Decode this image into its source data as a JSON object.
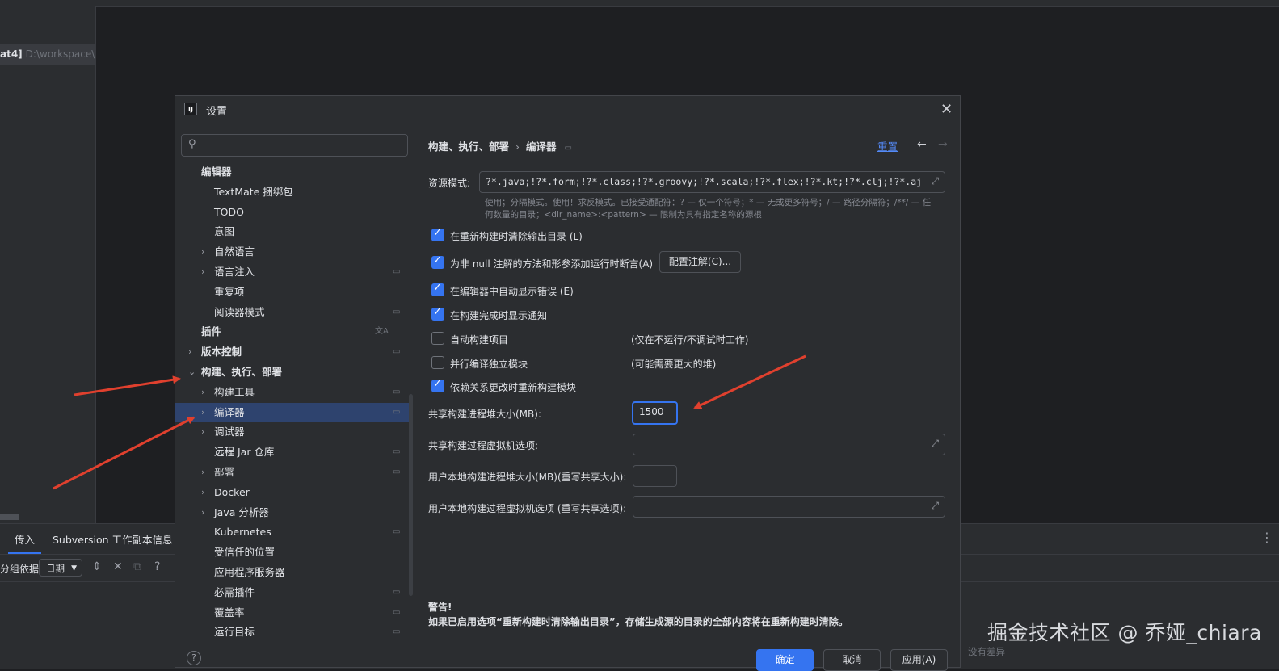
{
  "ide": {
    "tab_bold": "at4]",
    "tab_path": "D:\\workspace\\",
    "bottom_tabs": [
      "传入",
      "Subversion 工作副本信息"
    ],
    "group_by_label": "分组依据",
    "group_by_value": "日期",
    "no_diff": "没有差异",
    "more_icon": "more-vertical-icon"
  },
  "dialog": {
    "title": "设置",
    "search_placeholder": "",
    "tree": [
      {
        "label": "编辑器",
        "level": 0,
        "bold": true,
        "chevron": "",
        "pinned": false
      },
      {
        "label": "TextMate 捆绑包",
        "level": 1,
        "bold": false,
        "chevron": "",
        "pinned": false
      },
      {
        "label": "TODO",
        "level": 1,
        "bold": false,
        "chevron": "",
        "pinned": false
      },
      {
        "label": "意图",
        "level": 1,
        "bold": false,
        "chevron": "",
        "pinned": false
      },
      {
        "label": "自然语言",
        "level": 1,
        "bold": false,
        "chevron": "›",
        "pinned": false
      },
      {
        "label": "语言注入",
        "level": 1,
        "bold": false,
        "chevron": "›",
        "pinned": true
      },
      {
        "label": "重复项",
        "level": 1,
        "bold": false,
        "chevron": "",
        "pinned": false
      },
      {
        "label": "阅读器模式",
        "level": 1,
        "bold": false,
        "chevron": "",
        "pinned": true
      },
      {
        "label": "插件",
        "level": 0,
        "bold": true,
        "chevron": "",
        "pinned": false,
        "translate": true
      },
      {
        "label": "版本控制",
        "level": 0,
        "bold": true,
        "chevron": "›",
        "pinned": true
      },
      {
        "label": "构建、执行、部署",
        "level": 0,
        "bold": true,
        "chevron": "⌄",
        "pinned": false
      },
      {
        "label": "构建工具",
        "level": 1,
        "bold": false,
        "chevron": "›",
        "pinned": true
      },
      {
        "label": "编译器",
        "level": 1,
        "bold": false,
        "chevron": "›",
        "pinned": true,
        "selected": true
      },
      {
        "label": "调试器",
        "level": 1,
        "bold": false,
        "chevron": "›",
        "pinned": false
      },
      {
        "label": "远程 Jar 仓库",
        "level": 1,
        "bold": false,
        "chevron": "",
        "pinned": true
      },
      {
        "label": "部署",
        "level": 1,
        "bold": false,
        "chevron": "›",
        "pinned": true
      },
      {
        "label": "Docker",
        "level": 1,
        "bold": false,
        "chevron": "›",
        "pinned": false
      },
      {
        "label": "Java 分析器",
        "level": 1,
        "bold": false,
        "chevron": "›",
        "pinned": false
      },
      {
        "label": "Kubernetes",
        "level": 1,
        "bold": false,
        "chevron": "",
        "pinned": true
      },
      {
        "label": "受信任的位置",
        "level": 1,
        "bold": false,
        "chevron": "",
        "pinned": false
      },
      {
        "label": "应用程序服务器",
        "level": 1,
        "bold": false,
        "chevron": "",
        "pinned": false
      },
      {
        "label": "必需插件",
        "level": 1,
        "bold": false,
        "chevron": "",
        "pinned": true
      },
      {
        "label": "覆盖率",
        "level": 1,
        "bold": false,
        "chevron": "",
        "pinned": true
      },
      {
        "label": "运行目标",
        "level": 1,
        "bold": false,
        "chevron": "",
        "pinned": true
      }
    ],
    "breadcrumb": [
      "构建、执行、部署",
      "编译器"
    ],
    "reset": "重置",
    "resource_label": "资源模式:",
    "resource_value": "?*.java;!?*.form;!?*.class;!?*.groovy;!?*.scala;!?*.flex;!?*.kt;!?*.clj;!?*.aj",
    "hint_line1": "使用；分隔模式。使用！求反模式。已接受通配符：? — 仅一个符号；* — 无或更多符号；/ — 路径分隔符；/**/ — 任",
    "hint_line2": "何数量的目录；<dir_name>:<pattern> — 限制为具有指定名称的源根",
    "checkboxes": [
      {
        "label": "在重新构建时清除输出目录 (L)",
        "checked": true,
        "note": ""
      },
      {
        "label": "为非 null 注解的方法和形参添加运行时断言(A)",
        "checked": true,
        "note": ""
      },
      {
        "label": "在编辑器中自动显示错误 (E)",
        "checked": true,
        "note": ""
      },
      {
        "label": "在构建完成时显示通知",
        "checked": true,
        "note": ""
      },
      {
        "label": "自动构建项目",
        "checked": false,
        "note": "(仅在不运行/不调试时工作)"
      },
      {
        "label": "并行编译独立模块",
        "checked": false,
        "note": "(可能需要更大的堆)"
      },
      {
        "label": "依赖关系更改时重新构建模块",
        "checked": true,
        "note": ""
      }
    ],
    "config_annotations_button": "配置注解(C)...",
    "heap_label": "共享构建进程堆大小(MB):",
    "heap_value": "1500",
    "vm_label": "共享构建过程虚拟机选项:",
    "vm_value": "",
    "user_heap_label": "用户本地构建进程堆大小(MB)(重写共享大小):",
    "user_heap_value": "",
    "user_vm_label": "用户本地构建过程虚拟机选项 (重写共享选项):",
    "user_vm_value": "",
    "warning_title": "警告!",
    "warning_text": "如果已启用选项“重新构建时清除输出目录”，存储生成源的目录的全部内容将在重新构建时清除。",
    "buttons": {
      "ok": "确定",
      "cancel": "取消",
      "apply": "应用(A)"
    }
  },
  "watermark": "掘金技术社区 @ 乔娅_chiara",
  "colors": {
    "accent": "#3574f0",
    "link": "#548af7",
    "annotation_arrow": "#e0402e",
    "selection": "#2e436e"
  }
}
